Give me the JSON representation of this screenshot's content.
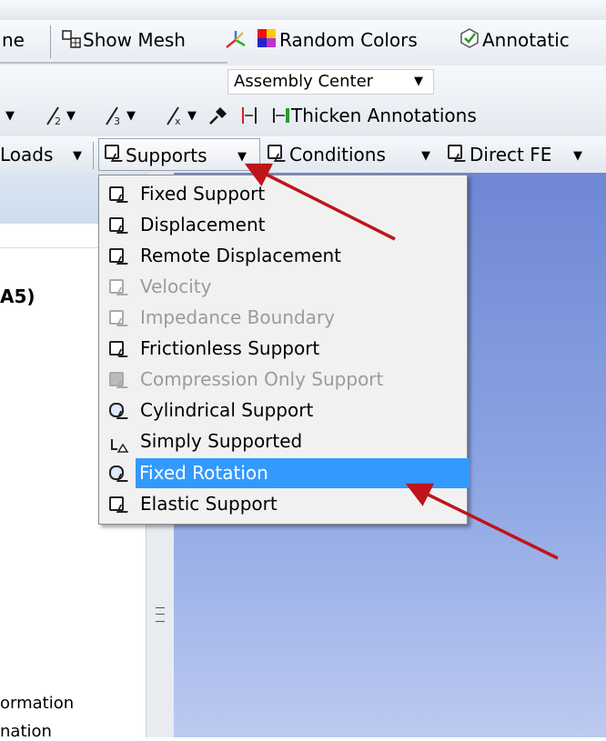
{
  "toolbar_top": {
    "mesh_partial": "ne",
    "show_mesh": "Show Mesh",
    "random_colors": "Random Colors",
    "annotations_partial": "Annotatic"
  },
  "toolbar_mid": {
    "assembly_center": "Assembly Center"
  },
  "toolbar_annot": {
    "thicken_annotations": "Thicken Annotations"
  },
  "toolbar_env": {
    "loads_partial": "Loads",
    "supports": "Supports",
    "conditions": "Conditions",
    "direct_fe": "Direct FE"
  },
  "left_panel": {
    "a5_partial": "A5)",
    "text1_partial": "ormation",
    "text2_partial": "nation"
  },
  "supports_menu": {
    "items": [
      {
        "label": "Fixed Support",
        "enabled": true,
        "selected": false,
        "icon": "fixed-support-icon"
      },
      {
        "label": "Displacement",
        "enabled": true,
        "selected": false,
        "icon": "displacement-icon"
      },
      {
        "label": "Remote Displacement",
        "enabled": true,
        "selected": false,
        "icon": "remote-displacement-icon"
      },
      {
        "label": "Velocity",
        "enabled": false,
        "selected": false,
        "icon": "velocity-icon"
      },
      {
        "label": "Impedance Boundary",
        "enabled": false,
        "selected": false,
        "icon": "impedance-boundary-icon"
      },
      {
        "label": "Frictionless Support",
        "enabled": true,
        "selected": false,
        "icon": "frictionless-support-icon"
      },
      {
        "label": "Compression Only Support",
        "enabled": false,
        "selected": false,
        "icon": "compression-only-support-icon"
      },
      {
        "label": "Cylindrical Support",
        "enabled": true,
        "selected": false,
        "icon": "cylindrical-support-icon"
      },
      {
        "label": "Simply Supported",
        "enabled": true,
        "selected": false,
        "icon": "simply-supported-icon"
      },
      {
        "label": "Fixed Rotation",
        "enabled": true,
        "selected": true,
        "icon": "fixed-rotation-icon"
      },
      {
        "label": "Elastic Support",
        "enabled": true,
        "selected": false,
        "icon": "elastic-support-icon"
      }
    ]
  },
  "colors": {
    "selection": "#3399ff",
    "annotation_arrow": "#c0141b",
    "graphics_bg": "#7e97dc"
  }
}
